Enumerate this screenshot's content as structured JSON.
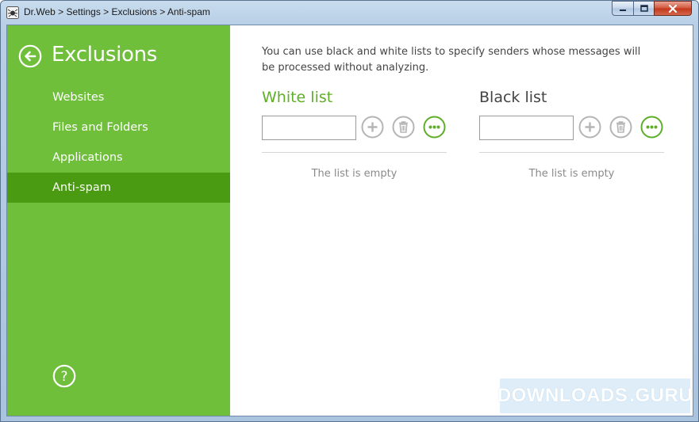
{
  "window": {
    "title": "Dr.Web > Settings > Exclusions > Anti-spam",
    "controls": {
      "minimize": "minimize",
      "maximize": "maximize",
      "close": "close"
    }
  },
  "sidebar": {
    "title": "Exclusions",
    "items": [
      {
        "label": "Websites",
        "active": false
      },
      {
        "label": "Files and Folders",
        "active": false
      },
      {
        "label": "Applications",
        "active": false
      },
      {
        "label": "Anti-spam",
        "active": true
      }
    ]
  },
  "main": {
    "description": "You can use black and white lists to specify senders whose messages will be processed without analyzing.",
    "white_list": {
      "title": "White list",
      "input_value": "",
      "empty_text": "The list is empty"
    },
    "black_list": {
      "title": "Black list",
      "input_value": "",
      "empty_text": "The list is empty"
    }
  },
  "watermark": {
    "text_left": "DOWNLOADS",
    "text_right": ".GURU"
  },
  "colors": {
    "sidebar_green": "#6fbf3b",
    "active_item_green": "#4a9a12",
    "accent_green": "#5fae2a",
    "button_gray": "#b5b5b5"
  },
  "icons": {
    "back": "arrow-left-circle-icon",
    "help": "question-circle-icon",
    "add": "plus-circle-icon",
    "delete": "trash-icon",
    "more": "ellipsis-circle-icon"
  }
}
